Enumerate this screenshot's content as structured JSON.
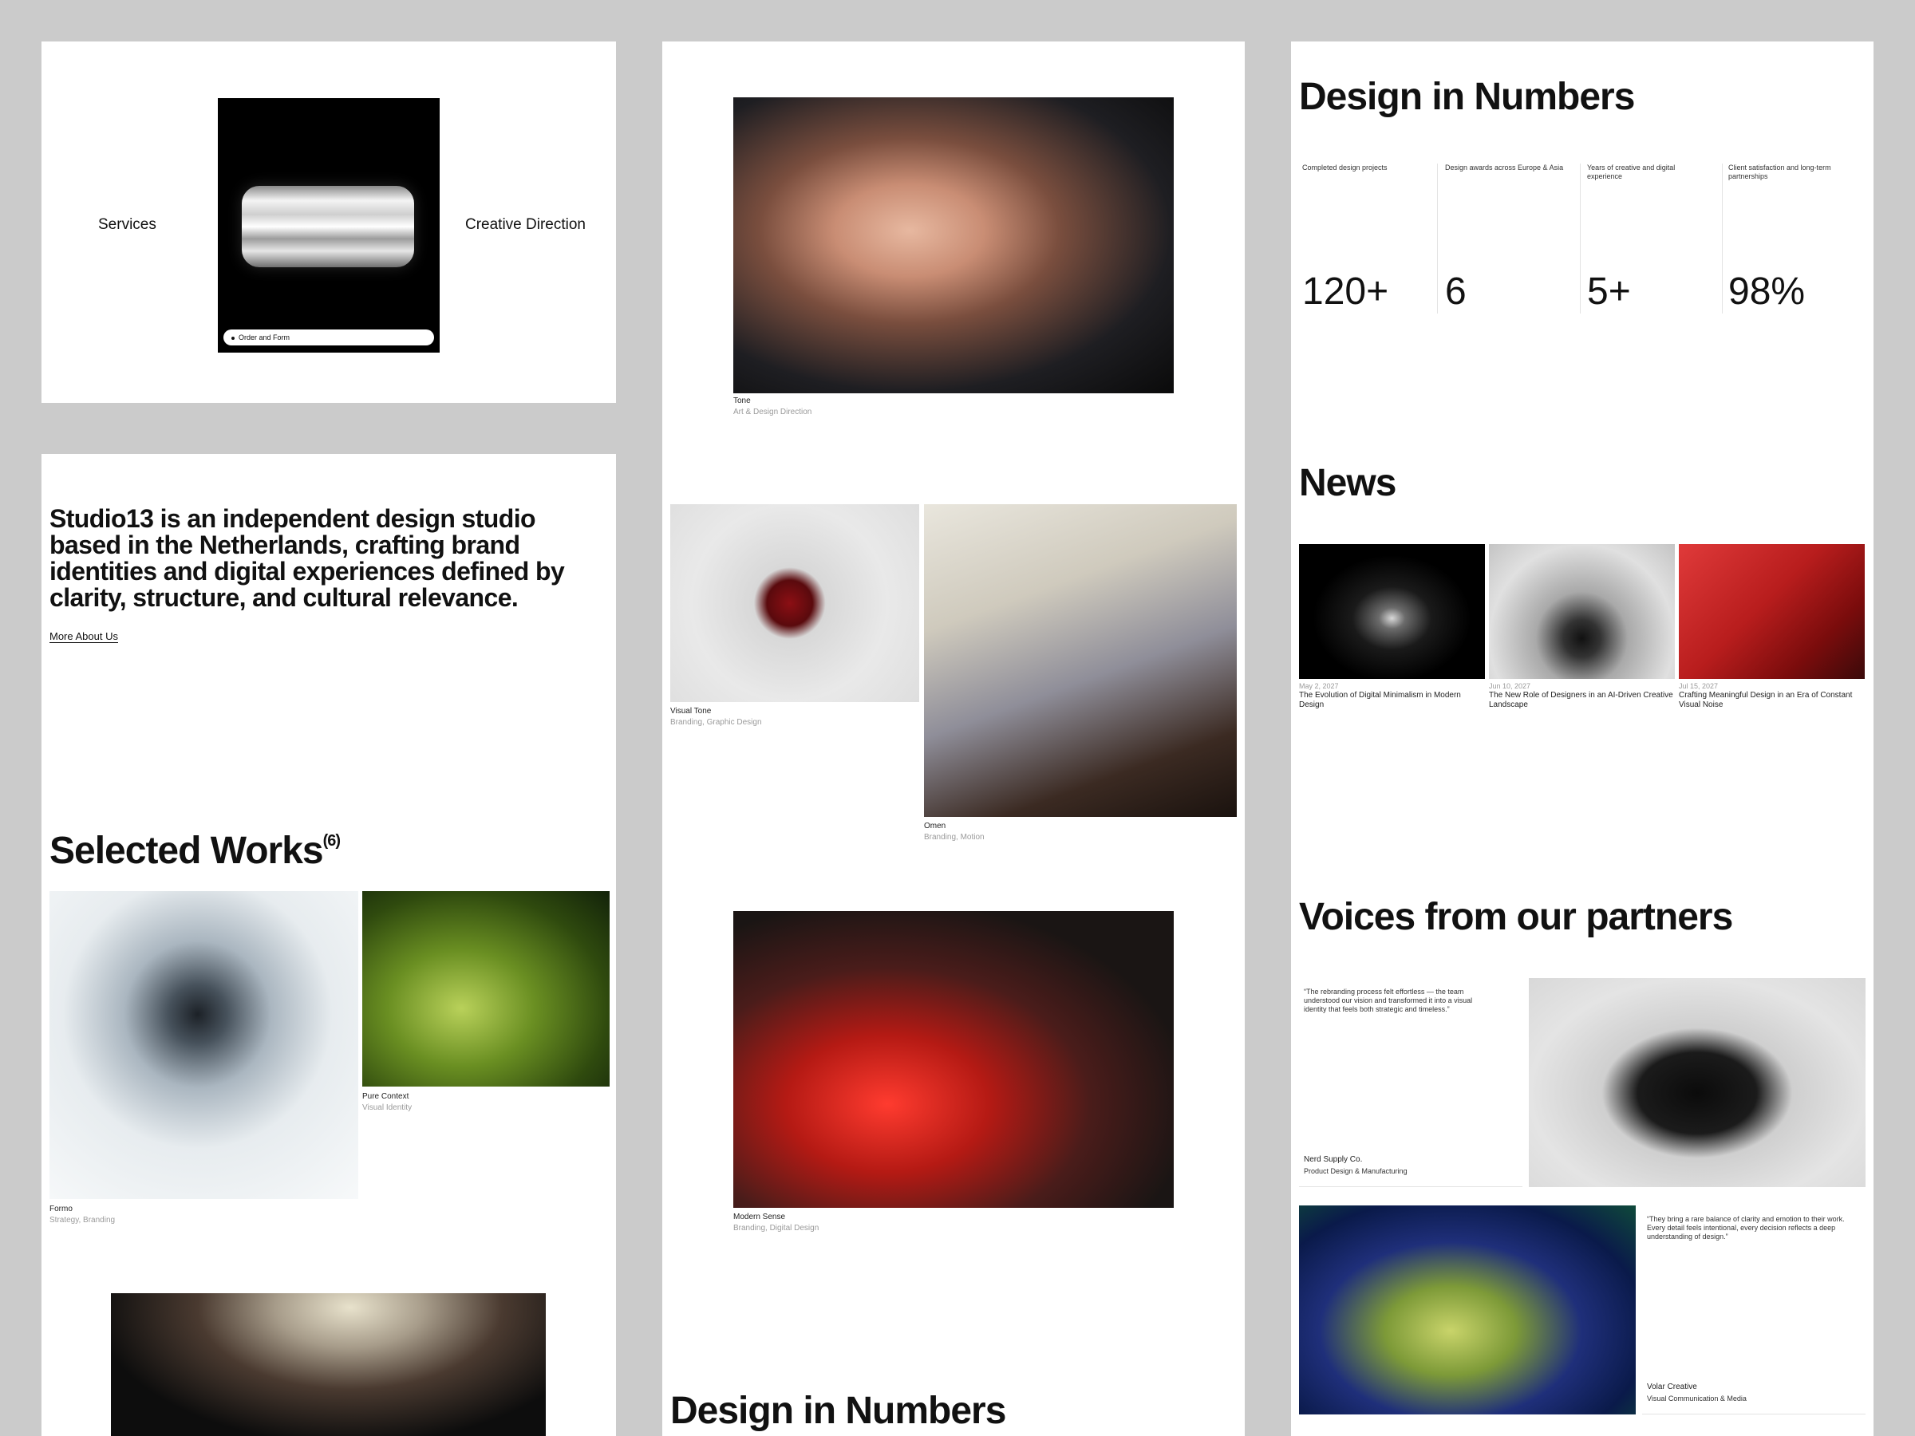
{
  "hero": {
    "left_label": "Services",
    "right_label": "Creative Direction",
    "pill_label": "Order and Form"
  },
  "intro": {
    "text": "Studio13 is an independent design studio based in the Netherlands, crafting brand identities and digital experiences defined by clarity, structure, and cultural relevance.",
    "link": "More About Us"
  },
  "selected_works": {
    "title": "Selected Works",
    "count": "(6)",
    "items": [
      {
        "title": "Formo",
        "tags": "Strategy, Branding"
      },
      {
        "title": "Pure Context",
        "tags": "Visual Identity"
      }
    ]
  },
  "portfolio": {
    "items": [
      {
        "title": "Tone",
        "tags": "Art & Design Direction"
      },
      {
        "title": "Visual Tone",
        "tags": "Branding, Graphic Design"
      },
      {
        "title": "Omen",
        "tags": "Branding, Motion"
      },
      {
        "title": "Modern Sense",
        "tags": "Branding, Digital Design"
      }
    ],
    "footer_title": "Design in Numbers"
  },
  "numbers": {
    "title": "Design in Numbers",
    "stats": [
      {
        "label": "Completed design projects",
        "value": "120+"
      },
      {
        "label": "Design awards across Europe & Asia",
        "value": "6"
      },
      {
        "label": "Years of creative and digital experience",
        "value": "5+"
      },
      {
        "label": "Client satisfaction and long-term partnerships",
        "value": "98%"
      }
    ]
  },
  "news": {
    "title": "News",
    "items": [
      {
        "date": "May 2, 2027",
        "title": "The Evolution of Digital Minimalism in Modern Design"
      },
      {
        "date": "Jun 10, 2027",
        "title": "The New Role of Designers in an AI-Driven Creative Landscape"
      },
      {
        "date": "Jul 15, 2027",
        "title": "Crafting Meaningful Design in an Era of Constant Visual Noise"
      }
    ]
  },
  "voices": {
    "title": "Voices from our partners",
    "items": [
      {
        "quote": "“The rebranding process felt effortless — the team understood our vision and transformed it into a visual identity that feels both strategic and timeless.”",
        "company": "Nerd Supply Co.",
        "role": "Product Design & Manufacturing"
      },
      {
        "quote": "“They bring a rare balance of clarity and emotion to their work. Every detail feels intentional, every decision reflects a deep understanding of design.”",
        "company": "Volar Creative",
        "role": "Visual Communication & Media"
      }
    ]
  }
}
